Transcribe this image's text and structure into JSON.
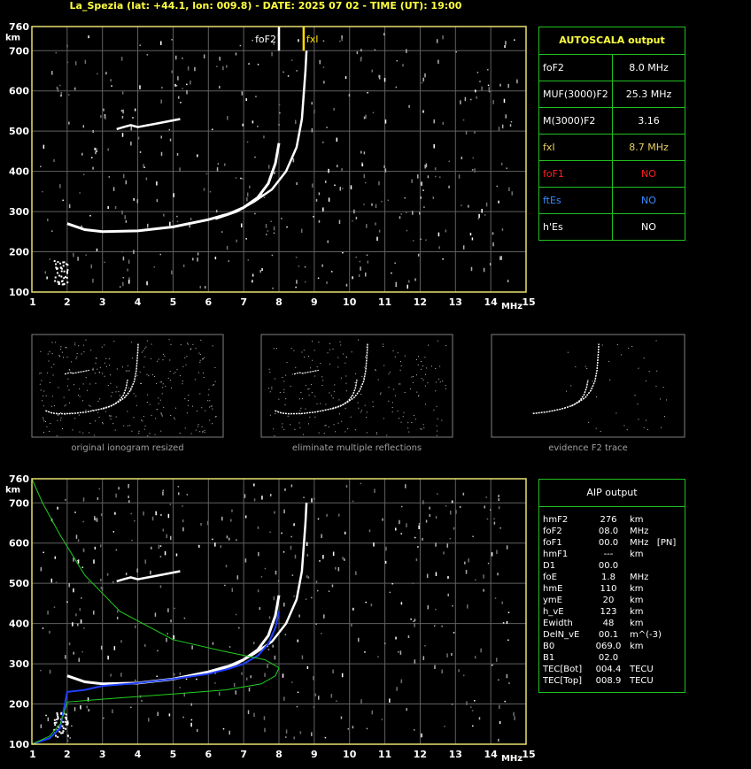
{
  "header": {
    "title": "La_Spezia (lat: +44.1, lon: 009.8) - DATE: 2025 07 02 - TIME (UT): 19:00"
  },
  "colors": {
    "axis": "#e8e070",
    "grid": "#606060",
    "panel_border": "#20c020",
    "trace": "#ffffff",
    "fxi": "#ffdd00",
    "profile_blue": "#2040ff",
    "profile_green": "#20d020",
    "red": "#ff2020",
    "blue": "#3a8cff",
    "yellow_value": "#e8d060"
  },
  "chart_data": [
    {
      "type": "scatter",
      "name_id": "ionogram-top",
      "x_ticks": [
        "1",
        "2",
        "3",
        "4",
        "5",
        "6",
        "7",
        "8",
        "9",
        "10",
        "11",
        "12",
        "13",
        "14",
        "15"
      ],
      "y_ticks": [
        "100",
        "200",
        "300",
        "400",
        "500",
        "600",
        "700",
        "760"
      ],
      "xlabel": "MHz",
      "ylabel": "km",
      "xlim": [
        1,
        15
      ],
      "ylim": [
        100,
        760
      ],
      "markers": [
        {
          "label": "foF2",
          "x": 8.0,
          "color": "#ffffff"
        },
        {
          "label": "fxI",
          "x": 8.7,
          "color": "#ffdd00"
        }
      ],
      "traces": {
        "o_mode": [
          [
            2.0,
            270
          ],
          [
            2.5,
            255
          ],
          [
            3.0,
            250
          ],
          [
            4.0,
            252
          ],
          [
            5.0,
            262
          ],
          [
            6.0,
            280
          ],
          [
            6.6,
            295
          ],
          [
            7.0,
            310
          ],
          [
            7.4,
            335
          ],
          [
            7.7,
            370
          ],
          [
            7.9,
            420
          ],
          [
            8.0,
            470
          ]
        ],
        "x_mode": [
          [
            6.2,
            282
          ],
          [
            6.8,
            300
          ],
          [
            7.3,
            325
          ],
          [
            7.8,
            355
          ],
          [
            8.2,
            400
          ],
          [
            8.5,
            460
          ],
          [
            8.65,
            530
          ],
          [
            8.75,
            650
          ],
          [
            8.78,
            700
          ]
        ],
        "es_patch": [
          [
            3.4,
            505
          ],
          [
            3.6,
            510
          ],
          [
            3.8,
            515
          ],
          [
            4.0,
            510
          ],
          [
            4.6,
            520
          ],
          [
            5.2,
            530
          ]
        ]
      }
    },
    {
      "type": "line",
      "name_id": "ionogram-bottom",
      "x_ticks": [
        "1",
        "2",
        "3",
        "4",
        "5",
        "6",
        "7",
        "8",
        "9",
        "10",
        "11",
        "12",
        "13",
        "14",
        "15"
      ],
      "y_ticks": [
        "100",
        "200",
        "300",
        "400",
        "500",
        "600",
        "700",
        "760"
      ],
      "xlabel": "MHz",
      "ylabel": "km",
      "xlim": [
        1,
        15
      ],
      "ylim": [
        100,
        760
      ],
      "traces": {
        "o_mode": [
          [
            2.0,
            270
          ],
          [
            2.5,
            255
          ],
          [
            3.0,
            250
          ],
          [
            4.0,
            252
          ],
          [
            5.0,
            262
          ],
          [
            6.0,
            280
          ],
          [
            6.6,
            295
          ],
          [
            7.0,
            310
          ],
          [
            7.4,
            335
          ],
          [
            7.7,
            370
          ],
          [
            7.9,
            420
          ],
          [
            8.0,
            470
          ]
        ],
        "x_mode": [
          [
            6.2,
            282
          ],
          [
            6.8,
            300
          ],
          [
            7.3,
            325
          ],
          [
            7.8,
            355
          ],
          [
            8.2,
            400
          ],
          [
            8.5,
            460
          ],
          [
            8.65,
            530
          ],
          [
            8.75,
            650
          ],
          [
            8.78,
            700
          ]
        ],
        "es_patch": [
          [
            3.4,
            505
          ],
          [
            3.6,
            510
          ],
          [
            3.8,
            515
          ],
          [
            4.0,
            510
          ],
          [
            4.6,
            520
          ],
          [
            5.2,
            530
          ]
        ],
        "blue_profile": [
          [
            1.0,
            100
          ],
          [
            1.5,
            115
          ],
          [
            1.8,
            140
          ],
          [
            2.0,
            230
          ],
          [
            2.5,
            235
          ],
          [
            3.0,
            245
          ],
          [
            4.0,
            252
          ],
          [
            5.0,
            262
          ],
          [
            6.0,
            275
          ],
          [
            6.6,
            288
          ],
          [
            7.0,
            300
          ],
          [
            7.4,
            320
          ],
          [
            7.7,
            350
          ],
          [
            7.9,
            390
          ],
          [
            8.0,
            430
          ]
        ],
        "green_profile": [
          [
            1.0,
            100
          ],
          [
            1.5,
            120
          ],
          [
            1.8,
            150
          ],
          [
            1.9,
            175
          ],
          [
            2.0,
            205
          ],
          [
            3.0,
            212
          ],
          [
            5.0,
            225
          ],
          [
            6.5,
            235
          ],
          [
            7.5,
            250
          ],
          [
            7.9,
            270
          ],
          [
            8.0,
            290
          ],
          [
            7.6,
            310
          ],
          [
            6.5,
            330
          ],
          [
            5.0,
            360
          ],
          [
            3.5,
            430
          ],
          [
            2.5,
            520
          ],
          [
            1.8,
            620
          ],
          [
            1.3,
            700
          ],
          [
            1.0,
            760
          ]
        ]
      }
    }
  ],
  "autoscala": {
    "title": "AUTOSCALA output",
    "rows": [
      {
        "key": "foF2",
        "value": "8.0 MHz",
        "key_color": "#ffffff",
        "value_color": "#ffffff"
      },
      {
        "key": "MUF(3000)F2",
        "value": "25.3 MHz",
        "key_color": "#ffffff",
        "value_color": "#ffffff"
      },
      {
        "key": "M(3000)F2",
        "value": "3.16",
        "key_color": "#ffffff",
        "value_color": "#ffffff"
      },
      {
        "key": "fxI",
        "value": "8.7 MHz",
        "key_color": "#e8d060",
        "value_color": "#e8d060"
      },
      {
        "key": "foF1",
        "value": "NO",
        "key_color": "#ff2020",
        "value_color": "#ff2020"
      },
      {
        "key": "ftEs",
        "value": "NO",
        "key_color": "#3a8cff",
        "value_color": "#3a8cff"
      },
      {
        "key": "h'Es",
        "value": "NO",
        "key_color": "#ffffff",
        "value_color": "#ffffff"
      }
    ]
  },
  "thumbnails": [
    {
      "caption": "original ionogram resized"
    },
    {
      "caption": "eliminate multiple reflections"
    },
    {
      "caption": "evidence F2 trace"
    }
  ],
  "aip": {
    "title": "AIP output",
    "rows": [
      {
        "k": "hmF2",
        "v": "276",
        "u": "km"
      },
      {
        "k": "foF2",
        "v": "08.0",
        "u": "MHz"
      },
      {
        "k": "foF1",
        "v": "00.0",
        "u": "MHz   [PN]"
      },
      {
        "k": "hmF1",
        "v": "---",
        "u": "km"
      },
      {
        "k": "D1",
        "v": "00.0",
        "u": ""
      },
      {
        "k": "foE",
        "v": "1.8",
        "u": "MHz"
      },
      {
        "k": "hmE",
        "v": "110",
        "u": "km"
      },
      {
        "k": "ymE",
        "v": "20",
        "u": "km"
      },
      {
        "k": "h_vE",
        "v": "123",
        "u": "km"
      },
      {
        "k": "Ewidth",
        "v": "48",
        "u": "km"
      },
      {
        "k": "DelN_vE",
        "v": "00.1",
        "u": "m^(-3)"
      },
      {
        "k": "B0",
        "v": "069.0",
        "u": "km"
      },
      {
        "k": "B1",
        "v": "02.0",
        "u": ""
      },
      {
        "k": "TEC[Bot]",
        "v": "004.4",
        "u": "TECU"
      },
      {
        "k": "TEC[Top]",
        "v": "008.9",
        "u": "TECU"
      }
    ]
  }
}
